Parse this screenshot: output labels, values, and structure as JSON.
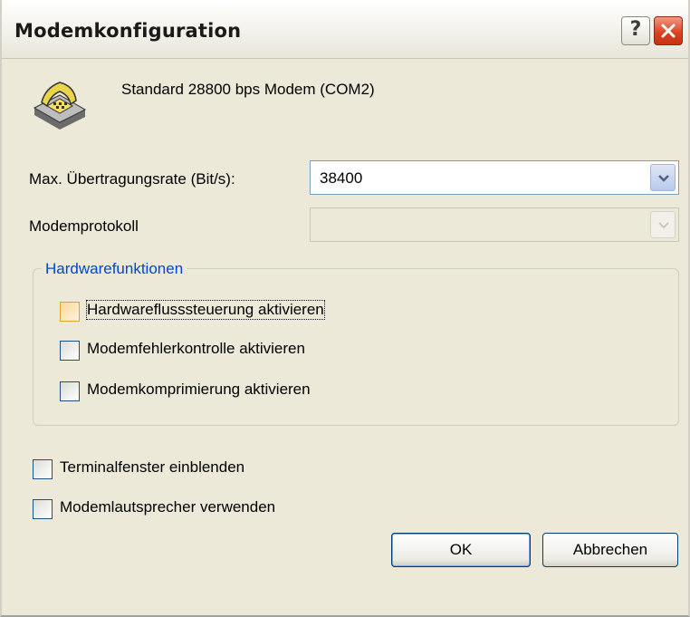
{
  "window": {
    "title": "Modemkonfiguration",
    "help_label": "?",
    "close_label": "✕"
  },
  "device": {
    "name": "Standard 28800 bps Modem (COM2)",
    "icon": "modem-phone-icon"
  },
  "rate": {
    "label": "Max. Übertragungsrate (Bit/s):",
    "value": "38400"
  },
  "protocol": {
    "label": "Modemprotokoll",
    "value": ""
  },
  "hardware": {
    "group_title": "Hardwarefunktionen",
    "options": [
      {
        "label": "Hardwareflusssteuerung aktivieren",
        "checked": false
      },
      {
        "label": "Modemfehlerkontrolle aktivieren",
        "checked": false
      },
      {
        "label": "Modemkomprimierung aktivieren",
        "checked": false
      }
    ]
  },
  "options": [
    {
      "label": "Terminalfenster einblenden",
      "checked": false
    },
    {
      "label": "Modemlautsprecher verwenden",
      "checked": false
    }
  ],
  "buttons": {
    "ok": "OK",
    "cancel": "Abbrechen"
  },
  "colors": {
    "dialog_bg": "#ece9d8",
    "group_title": "#0046d5",
    "close_red": "#d8401f"
  }
}
